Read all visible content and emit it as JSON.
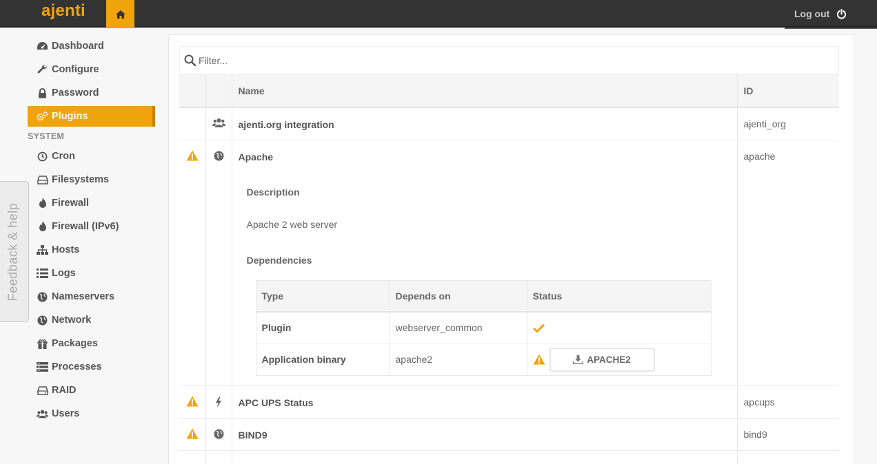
{
  "app": {
    "brand": "ajenti",
    "logout_label": "Log out"
  },
  "colors": {
    "accent": "#f0a30a",
    "topbar": "#333333",
    "warning": "#f0a30a"
  },
  "sidebar": {
    "items": [
      {
        "label": "Dashboard",
        "icon": "dashboard-icon"
      },
      {
        "label": "Configure",
        "icon": "wrench-icon"
      },
      {
        "label": "Password",
        "icon": "lock-icon"
      },
      {
        "label": "Plugins",
        "icon": "cogs-icon",
        "active": true
      }
    ],
    "section": "SYSTEM",
    "system_items": [
      {
        "label": "Cron",
        "icon": "clock-icon"
      },
      {
        "label": "Filesystems",
        "icon": "hdd-icon"
      },
      {
        "label": "Firewall",
        "icon": "fire-icon"
      },
      {
        "label": "Firewall (IPv6)",
        "icon": "fire-icon"
      },
      {
        "label": "Hosts",
        "icon": "sitemap-icon"
      },
      {
        "label": "Logs",
        "icon": "list-icon"
      },
      {
        "label": "Nameservers",
        "icon": "globe-icon"
      },
      {
        "label": "Network",
        "icon": "globe-icon"
      },
      {
        "label": "Packages",
        "icon": "gift-icon"
      },
      {
        "label": "Processes",
        "icon": "tasks-icon"
      },
      {
        "label": "RAID",
        "icon": "hdd-icon"
      },
      {
        "label": "Users",
        "icon": "users-icon"
      }
    ]
  },
  "feedback": {
    "label": "Feedback & help"
  },
  "filter": {
    "placeholder": "Filter..."
  },
  "table": {
    "headers": [
      "",
      "",
      "Name",
      "ID"
    ],
    "rows": [
      {
        "warning": false,
        "icon": "users-icon",
        "name": "ajenti.org integration",
        "id": "ajenti_org"
      },
      {
        "warning": true,
        "icon": "globe-icon",
        "name": "Apache",
        "id": "apache",
        "expanded": true
      },
      {
        "warning": true,
        "icon": "bolt-icon",
        "name": "APC UPS Status",
        "id": "apcups"
      },
      {
        "warning": true,
        "icon": "globe-icon",
        "name": "BIND9",
        "id": "bind9"
      }
    ]
  },
  "details": {
    "description_heading": "Description",
    "description": "Apache 2 web server",
    "dependencies_heading": "Dependencies",
    "dep_headers": [
      "Type",
      "Depends on",
      "Status"
    ],
    "deps": [
      {
        "type": "Plugin",
        "depends_on": "webserver_common",
        "status": "ok"
      },
      {
        "type": "Application binary",
        "depends_on": "apache2",
        "status": "missing",
        "install_label": "APACHE2"
      }
    ]
  }
}
